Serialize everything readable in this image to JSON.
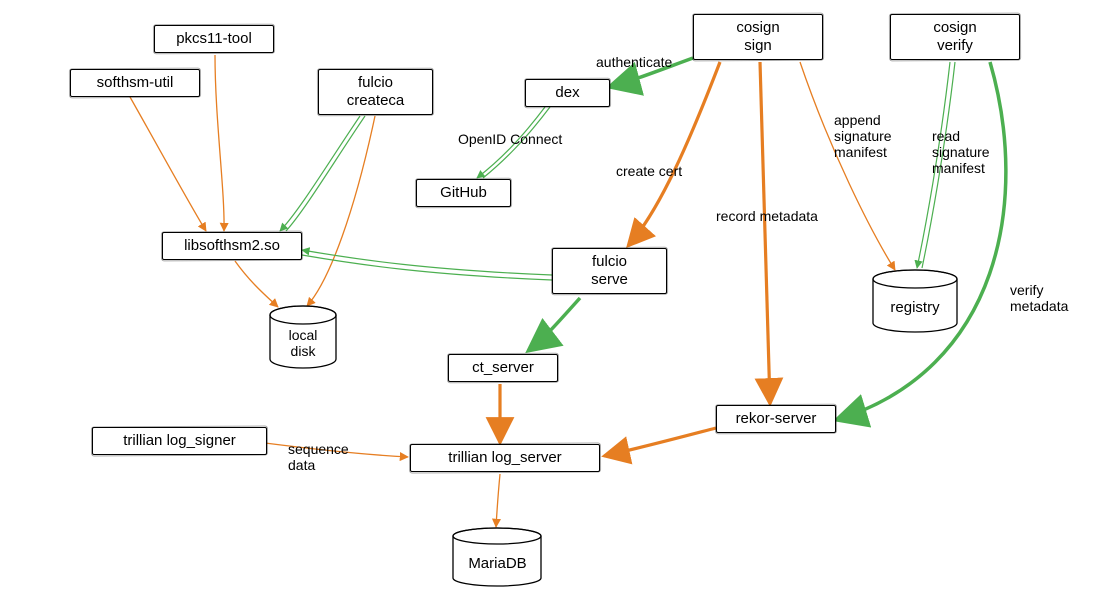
{
  "nodes": {
    "pkcs11_tool": "pkcs11-tool",
    "softhsm_util": "softhsm-util",
    "fulcio_createca": "fulcio\ncreateca",
    "libsofthsm2": "libsofthsm2.so",
    "local_disk": "local\ndisk",
    "dex": "dex",
    "github": "GitHub",
    "cosign_sign": "cosign\nsign",
    "cosign_verify": "cosign\nverify",
    "fulcio_serve": "fulcio\nserve",
    "ct_server": "ct_server",
    "trillian_log_signer": "trillian log_signer",
    "trillian_log_server": "trillian log_server",
    "mariadb": "MariaDB",
    "rekor_server": "rekor-server",
    "registry": "registry"
  },
  "edge_labels": {
    "authenticate": "authenticate",
    "openid_connect": "OpenID Connect",
    "create_cert": "create cert",
    "record_metadata": "record metadata",
    "append_sig_manifest": "append\nsignature\nmanifest",
    "read_sig_manifest": "read\nsignature\nmanifest",
    "verify_metadata": "verify\nmetadata",
    "sequence_data": "sequence\ndata"
  },
  "edges": [
    {
      "from": "pkcs11_tool",
      "to": "libsofthsm2",
      "style": "orange-thin"
    },
    {
      "from": "softhsm_util",
      "to": "libsofthsm2",
      "style": "orange-thin"
    },
    {
      "from": "fulcio_createca",
      "to": "libsofthsm2",
      "style": "green-double"
    },
    {
      "from": "fulcio_createca",
      "to": "local_disk",
      "style": "orange-thin"
    },
    {
      "from": "libsofthsm2",
      "to": "local_disk",
      "style": "orange-thin"
    },
    {
      "from": "cosign_sign",
      "to": "dex",
      "style": "green-thick",
      "label": "authenticate"
    },
    {
      "from": "dex",
      "to": "github",
      "style": "green-double",
      "label": "openid_connect"
    },
    {
      "from": "cosign_sign",
      "to": "fulcio_serve",
      "style": "orange-thick",
      "label": "create_cert"
    },
    {
      "from": "cosign_sign",
      "to": "rekor_server",
      "style": "orange-thick",
      "label": "record_metadata"
    },
    {
      "from": "cosign_sign",
      "to": "registry",
      "style": "orange-thin",
      "label": "append_sig_manifest"
    },
    {
      "from": "cosign_verify",
      "to": "registry",
      "style": "green-double",
      "label": "read_sig_manifest"
    },
    {
      "from": "cosign_verify",
      "to": "rekor_server",
      "style": "green-thick",
      "label": "verify_metadata"
    },
    {
      "from": "fulcio_serve",
      "to": "libsofthsm2",
      "style": "green-double"
    },
    {
      "from": "fulcio_serve",
      "to": "ct_server",
      "style": "green-thick"
    },
    {
      "from": "ct_server",
      "to": "trillian_log_server",
      "style": "orange-thick"
    },
    {
      "from": "rekor_server",
      "to": "trillian_log_server",
      "style": "orange-thick"
    },
    {
      "from": "trillian_log_signer",
      "to": "trillian_log_server",
      "style": "orange-thin",
      "label": "sequence_data"
    },
    {
      "from": "trillian_log_server",
      "to": "mariadb",
      "style": "orange-thin"
    }
  ],
  "colors": {
    "orange": "#e67e22",
    "green": "#4caf50",
    "black": "#000000"
  }
}
